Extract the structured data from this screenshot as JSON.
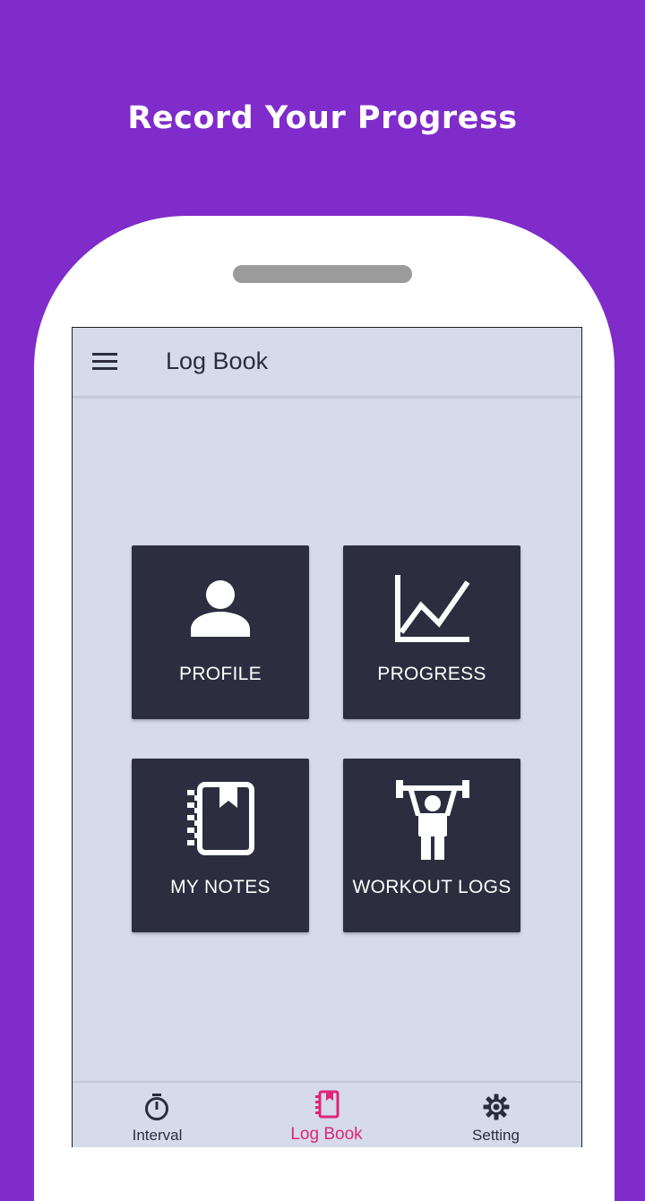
{
  "headline": "Record Your Progress",
  "appbar": {
    "title": "Log Book",
    "menu_icon": "hamburger-menu-icon"
  },
  "tiles": [
    {
      "label": "PROFILE",
      "icon": "person-icon"
    },
    {
      "label": "PROGRESS",
      "icon": "line-chart-icon"
    },
    {
      "label": "MY NOTES",
      "icon": "notebook-icon"
    },
    {
      "label": "WORKOUT LOGS",
      "icon": "weightlifter-icon"
    }
  ],
  "bottom_nav": {
    "items": [
      {
        "label": "Interval",
        "icon": "stopwatch-icon",
        "active": false
      },
      {
        "label": "Log Book",
        "icon": "notebook-icon",
        "active": true
      },
      {
        "label": "Setting",
        "icon": "gear-icon",
        "active": false
      }
    ]
  },
  "colors": {
    "background": "#7f2ccb",
    "screen": "#d5dbea",
    "tile": "#2c2e40",
    "active_nav": "#e0247a",
    "text_dark": "#2b2d3c"
  }
}
